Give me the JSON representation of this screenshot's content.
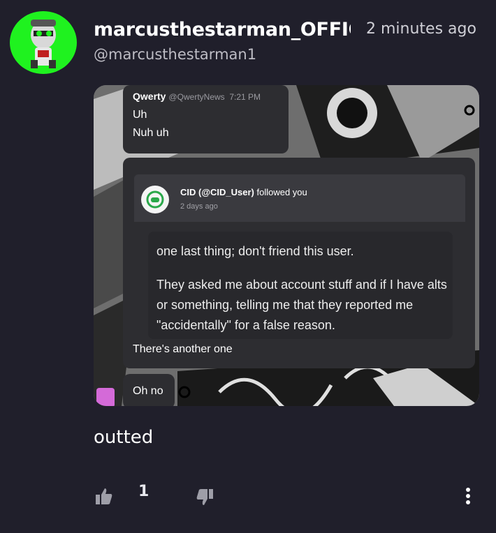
{
  "post": {
    "username": "marcusthestarman_OFFICIAL",
    "timestamp": "2 minutes ago",
    "handle": "@marcusthestarman1",
    "caption": "outted",
    "like_count": "1"
  },
  "media": {
    "msg1": {
      "name": "Qwerty",
      "handle": "@QwertyNews",
      "time": "7:21 PM",
      "line1": "Uh",
      "line2": "Nuh uh"
    },
    "notification": {
      "user": "CID (@CID_User)",
      "action": "followed you",
      "time": "2 days ago"
    },
    "quote": {
      "p1": "one last thing; don't friend this user.",
      "p2": "They asked me about account stuff and if I have alts or something, telling me that they reported me \"accidentally\" for a false reason."
    },
    "msg2_footer": "There's another one",
    "msg3": "Oh no"
  },
  "colors": {
    "background": "#201f2b",
    "avatar_bg": "#1ff21f"
  },
  "icons": [
    "thumbs-up-icon",
    "thumbs-down-icon",
    "more-vertical-icon"
  ]
}
